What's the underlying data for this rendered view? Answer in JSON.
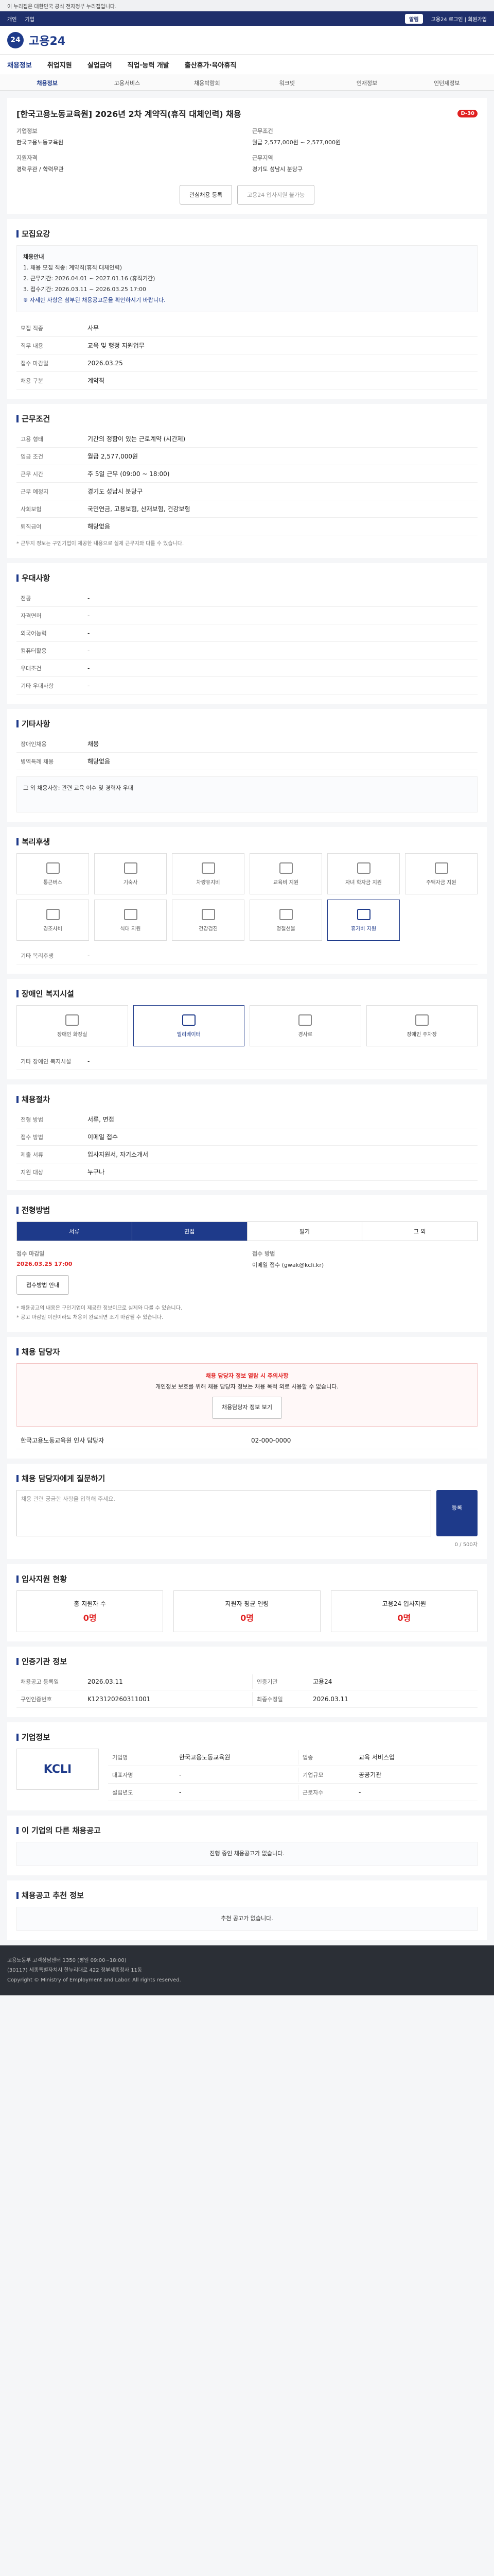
{
  "gov_notice": "이 누리집은 대한민국 공식 전자정부 누리집입니다.",
  "util": {
    "links": [
      "개인",
      "기업"
    ],
    "right": "고용24 로그인 | 회원가입",
    "pill": "알림"
  },
  "brand": "고용24",
  "gnb": [
    "채용정보",
    "취업지원",
    "실업급여",
    "직업·능력 개발",
    "출산휴가·육아휴직"
  ],
  "lnb": [
    "채용정보",
    "고용서비스",
    "채용박람회",
    "워크넷",
    "인재정보",
    "인턴제정보"
  ],
  "posting": {
    "title": "[한국고용노동교육원] 2026년 2차 계약직(휴직 대체인력) 채용",
    "dday": "D-30",
    "company_label": "기업정보",
    "company": "한국고용노동교육원",
    "condition_label": "근무조건",
    "condition": "월급 2,577,000원 ~ 2,577,000원",
    "qual_label": "지원자격",
    "qual": "경력무관 / 학력무관",
    "place_label": "근무지역",
    "place": "경기도 성남시 분당구",
    "btn_interest": "관심채용 등록",
    "btn_apply": "고용24 입사지원 불가능"
  },
  "recruit": {
    "title": "모집요강",
    "notice_lines": [
      "채용안내",
      "1. 채용 모집 직종: 계약직(휴직 대체인력)",
      "2. 근무기간: 2026.04.01 ~ 2027.01.16 (휴직기간)",
      "3. 접수기간: 2026.03.11 ~ 2026.03.25 17:00",
      "※ 자세한 사항은 첨부된 채용공고문을 확인하시기 바랍니다."
    ],
    "rows": [
      [
        "모집 직종",
        "사무"
      ],
      [
        "직무 내용",
        "교육 및 행정 지원업무"
      ],
      [
        "접수 마감일",
        "2026.03.25"
      ],
      [
        "채용 구분",
        "계약직"
      ]
    ]
  },
  "conditions": {
    "title": "근무조건",
    "rows": [
      [
        "고용 형태",
        "기간의 정함이 있는 근로계약 (시간제)"
      ],
      [
        "임금 조건",
        "월급 2,577,000원"
      ],
      [
        "근무 시간",
        "주 5일 근무 (09:00 ~ 18:00)"
      ],
      [
        "근무 예정지",
        "경기도 성남시 분당구"
      ],
      [
        "사회보험",
        "국민연금, 고용보험, 산재보험, 건강보험"
      ],
      [
        "퇴직급여",
        "해당없음"
      ]
    ],
    "note": "* 근무지 정보는 구인기업이 제공한 내용으로 실제 근무지와 다를 수 있습니다."
  },
  "preferences": {
    "title": "우대사항",
    "rows": [
      [
        "전공",
        "-"
      ],
      [
        "자격면허",
        "-"
      ],
      [
        "외국어능력",
        "-"
      ],
      [
        "컴퓨터활용",
        "-"
      ],
      [
        "우대조건",
        "-"
      ],
      [
        "기타 우대사항",
        "-"
      ]
    ]
  },
  "etc": {
    "title": "기타사항",
    "rows": [
      [
        "장애인채용",
        "채용"
      ],
      [
        "병역특례 채용",
        "해당없음"
      ]
    ],
    "text": "그 외 채용사항: 관련 교육 이수 및 경력자 우대"
  },
  "welfare": {
    "title": "복리후생",
    "items": [
      "통근버스",
      "기숙사",
      "차량유지비",
      "교육비 지원",
      "자녀 학자금 지원",
      "주택자금 지원",
      "경조사비",
      "식대 지원",
      "건강검진",
      "명절선물",
      "휴가비 지원"
    ],
    "active_index": 10,
    "foot_label": "기타 복리후생",
    "foot_value": "-"
  },
  "disability": {
    "title": "장애인 복지시설",
    "items": [
      "장애인 화장실",
      "엘리베이터",
      "경사로",
      "장애인 주차장"
    ],
    "foot_label": "기타 장애인 복지시설",
    "foot_value": "-"
  },
  "hiring": {
    "title": "채용절차",
    "rows": [
      [
        "전형 방법",
        "서류, 면접"
      ],
      [
        "접수 방법",
        "이메일 접수"
      ],
      [
        "제출 서류",
        "입사지원서, 자기소개서"
      ],
      [
        "지원 대상",
        "누구나"
      ]
    ]
  },
  "process": {
    "title": "전형방법",
    "tabs": [
      "서류",
      "면접",
      "필기",
      "그 외"
    ],
    "deadline_label": "접수 마감일",
    "deadline": "2026.03.25 17:00",
    "method_label": "접수 방법",
    "method": "이메일 접수 (gwak@kcli.kr)",
    "btn": "접수방법 안내",
    "notes": [
      "* 채용공고의 내용은 구인기업이 제공한 정보이므로 실제와 다를 수 있습니다.",
      "* 공고 마감일 이전이라도 채용이 완료되면 조기 마감될 수 있습니다."
    ]
  },
  "contact": {
    "title": "채용 담당자",
    "warn_title": "채용 담당자 정보 열람 시 주의사항",
    "warn_text": "개인정보 보호를 위해 채용 담당자 정보는 채용 목적 외로 사용할 수 없습니다.",
    "warn_btn": "채용담당자 정보 보기",
    "person": "한국고용노동교육원 인사 담당자",
    "phone": "02-000-0000"
  },
  "inquiry": {
    "title": "채용 담당자에게 질문하기",
    "placeholder": "채용 관련 궁금한 사항을 입력해 주세요.",
    "btn": "등록",
    "count": "0 / 500자"
  },
  "apply_status": {
    "title": "입사지원 현황",
    "items": [
      [
        "총 지원자 수",
        "0명"
      ],
      [
        "지원자 평균 연령",
        "0명"
      ],
      [
        "고용24 입사지원",
        "0명"
      ]
    ]
  },
  "meta": {
    "title": "인증기관 정보",
    "rows": [
      [
        "채용공고 등록일",
        "2026.03.11"
      ],
      [
        "인증기관",
        "고용24"
      ],
      [
        "구인인증번호",
        "K123120260311001"
      ],
      [
        "최종수정일",
        "2026.03.11"
      ]
    ]
  },
  "company": {
    "title": "기업정보",
    "logo": "KCLI",
    "rows": [
      [
        "기업명",
        "한국고용노동교육원"
      ],
      [
        "업종",
        "교육 서비스업"
      ],
      [
        "대표자명",
        "-"
      ],
      [
        "기업규모",
        "공공기관"
      ],
      [
        "설립년도",
        "-"
      ],
      [
        "근로자수",
        "-"
      ]
    ]
  },
  "similar": {
    "title": "이 기업의 다른 채용공고",
    "empty": "진행 중인 채용공고가 없습니다."
  },
  "similar2": {
    "title": "채용공고 추천 정보",
    "empty": "추천 공고가 없습니다."
  },
  "footer": [
    "고용노동부 고객상담센터 1350 (평일 09:00~18:00)",
    "(30117) 세종특별자치시 한누리대로 422 정부세종청사 11동",
    "Copyright © Ministry of Employment and Labor. All rights reserved."
  ]
}
